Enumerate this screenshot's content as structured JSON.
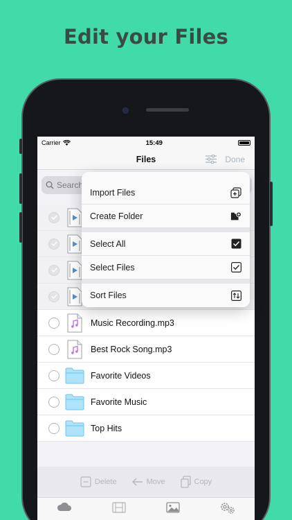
{
  "headline": "Edit your Files",
  "status": {
    "carrier": "Carrier",
    "time": "15:49"
  },
  "nav": {
    "title": "Files",
    "done": "Done"
  },
  "search": {
    "placeholder": "Search"
  },
  "menu": {
    "import": "Import Files",
    "create_folder": "Create Folder",
    "select_all": "Select All",
    "select_files": "Select Files",
    "sort": "Sort Files"
  },
  "files": [
    {
      "name": "Music Recording.mp3",
      "kind": "audio"
    },
    {
      "name": "Best Rock Song.mp3",
      "kind": "audio"
    },
    {
      "name": "Favorite Videos",
      "kind": "folder"
    },
    {
      "name": "Favorite Music",
      "kind": "folder"
    },
    {
      "name": "Top Hits",
      "kind": "folder"
    }
  ],
  "toolbar": {
    "delete": "Delete",
    "move": "Move",
    "copy": "Copy"
  },
  "colors": {
    "background": "#40dba8",
    "accent": "#4a90e2",
    "folder": "#aee3fb"
  }
}
